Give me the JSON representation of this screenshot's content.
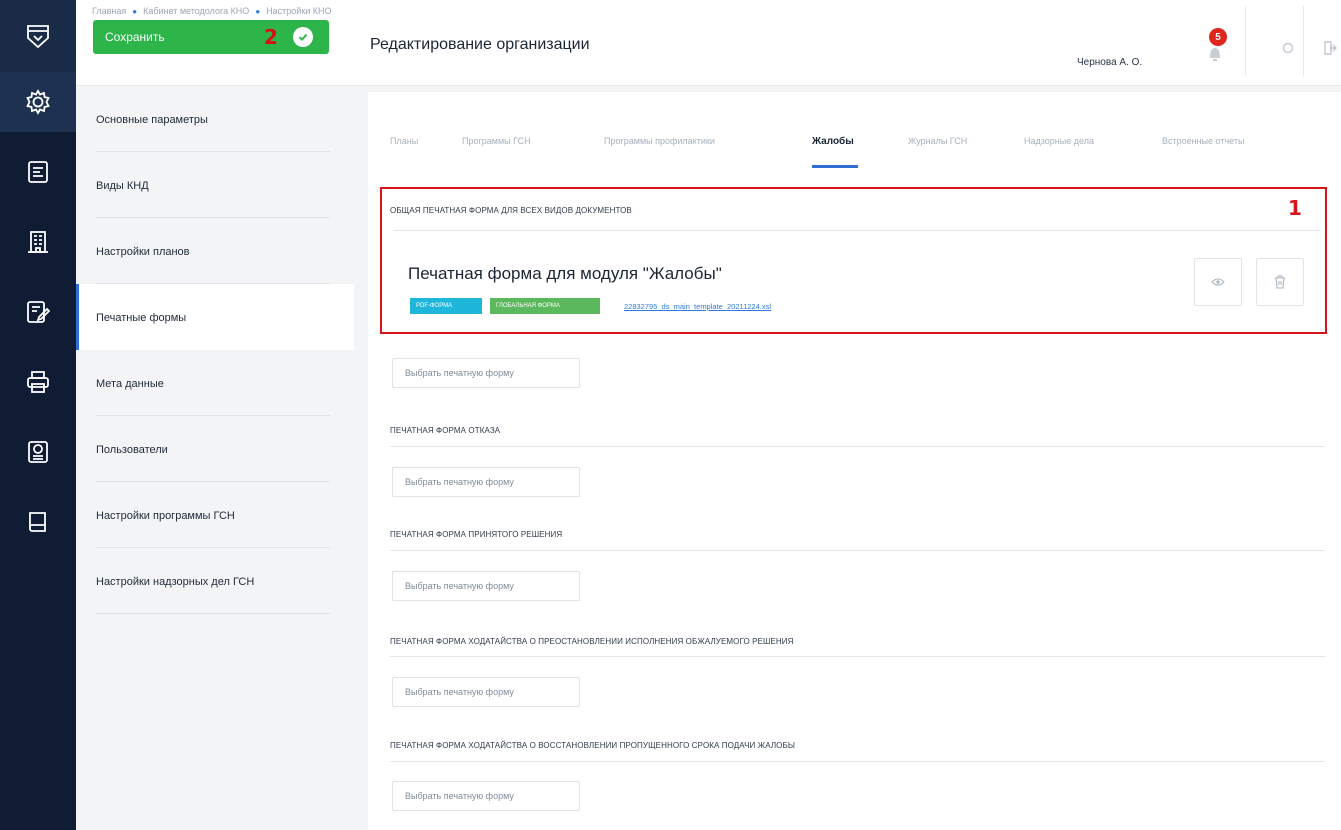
{
  "header": {
    "breadcrumbs": [
      "Главная",
      "Кабинет методолога КНО",
      "Настройки КНО"
    ],
    "save_button": "Сохранить",
    "save_marker": "2",
    "page_title": "Редактирование организации",
    "user_name": "Чернова А. О.",
    "notifications_count": "5"
  },
  "rail": {
    "items": [
      "logo-icon",
      "settings-gear-icon",
      "document-list-icon",
      "building-icon",
      "edit-form-icon",
      "printer-icon",
      "certificate-icon",
      "book-icon"
    ]
  },
  "subnav": {
    "items": [
      {
        "label": "Основные параметры",
        "active": false
      },
      {
        "label": "Виды КНД",
        "active": false
      },
      {
        "label": "Настройки планов",
        "active": false
      },
      {
        "label": "Печатные формы",
        "active": true
      },
      {
        "label": "Мета данные",
        "active": false
      },
      {
        "label": "Пользователи",
        "active": false
      },
      {
        "label": "Настройки программы ГСН",
        "active": false
      },
      {
        "label": "Настройки надзорных дел ГСН",
        "active": false
      }
    ]
  },
  "tabs": [
    {
      "label": "Планы",
      "active": false
    },
    {
      "label": "Программы ГСН",
      "active": false
    },
    {
      "label": "Программы профилактики",
      "active": false
    },
    {
      "label": "Жалобы",
      "active": true
    },
    {
      "label": "Журналы ГСН",
      "active": false
    },
    {
      "label": "Надзорные дела",
      "active": false
    },
    {
      "label": "Встроенные отчеты",
      "active": false
    }
  ],
  "common_form": {
    "section_title": "ОБЩАЯ ПЕЧАТНАЯ ФОРМА ДЛЯ ВСЕХ ВИДОВ ДОКУМЕНТОВ",
    "marker": "1",
    "form_title": "Печатная форма для модуля \"Жалобы\"",
    "tag_pdf": "PDF-форма",
    "tag_global": "Глобальная форма",
    "file_name": "22832795_ds_main_template_20211224.xsl"
  },
  "select_button_label": "Выбрать печатную форму",
  "sections": [
    {
      "title": "ПЕЧАТНАЯ ФОРМА ОТКАЗА"
    },
    {
      "title": "ПЕЧАТНАЯ ФОРМА ПРИНЯТОГО РЕШЕНИЯ"
    },
    {
      "title": "ПЕЧАТНАЯ ФОРМА ХОДАТАЙСТВА О ПРЕОСТАНОВЛЕНИИ ИСПОЛНЕНИЯ ОБЖАЛУЕМОГО РЕШЕНИЯ"
    },
    {
      "title": "ПЕЧАТНАЯ ФОРМА ХОДАТАЙСТВА О ВОССТАНОВЛЕНИИ ПРОПУЩЕННОГО СРОКА ПОДАЧИ ЖАЛОБЫ"
    }
  ],
  "colors": {
    "primary": "#2d6fd2",
    "success": "#2db54a",
    "highlight": "#d8141b",
    "rail": "#0f1c33"
  }
}
